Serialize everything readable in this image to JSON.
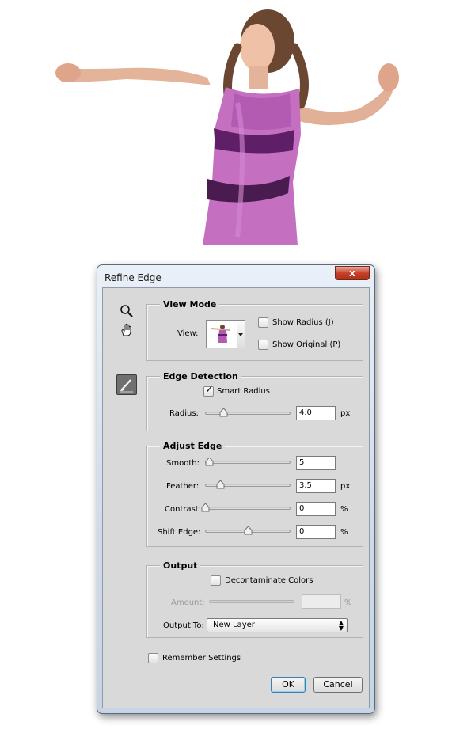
{
  "dialog": {
    "title": "Refine Edge",
    "close_label": "x"
  },
  "tools": {
    "zoom": "zoom-icon",
    "hand": "hand-icon",
    "refine_brush": "refine-radius-brush-icon"
  },
  "view_mode": {
    "legend": "View Mode",
    "view_label": "View:",
    "show_radius": {
      "label": "Show Radius (J)",
      "checked": false
    },
    "show_original": {
      "label": "Show Original (P)",
      "checked": false
    }
  },
  "edge_detection": {
    "legend": "Edge Detection",
    "smart_radius": {
      "label": "Smart Radius",
      "checked": true
    },
    "radius": {
      "label": "Radius:",
      "value": "4.0",
      "unit": "px",
      "slider": 0.2
    }
  },
  "adjust_edge": {
    "legend": "Adjust Edge",
    "smooth": {
      "label": "Smooth:",
      "value": "5",
      "unit": "",
      "slider": 0.05
    },
    "feather": {
      "label": "Feather:",
      "value": "3.5",
      "unit": "px",
      "slider": 0.17
    },
    "contrast": {
      "label": "Contrast:",
      "value": "0",
      "unit": "%",
      "slider": 0.0
    },
    "shift_edge": {
      "label": "Shift Edge:",
      "value": "0",
      "unit": "%",
      "slider": 0.5
    }
  },
  "output": {
    "legend": "Output",
    "decontaminate": {
      "label": "Decontaminate Colors",
      "checked": false
    },
    "amount": {
      "label": "Amount:",
      "value": "",
      "unit": "%"
    },
    "output_to": {
      "label": "Output To:",
      "selected": "New Layer"
    }
  },
  "remember_settings": {
    "label": "Remember Settings",
    "checked": false
  },
  "buttons": {
    "ok": "OK",
    "cancel": "Cancel"
  }
}
